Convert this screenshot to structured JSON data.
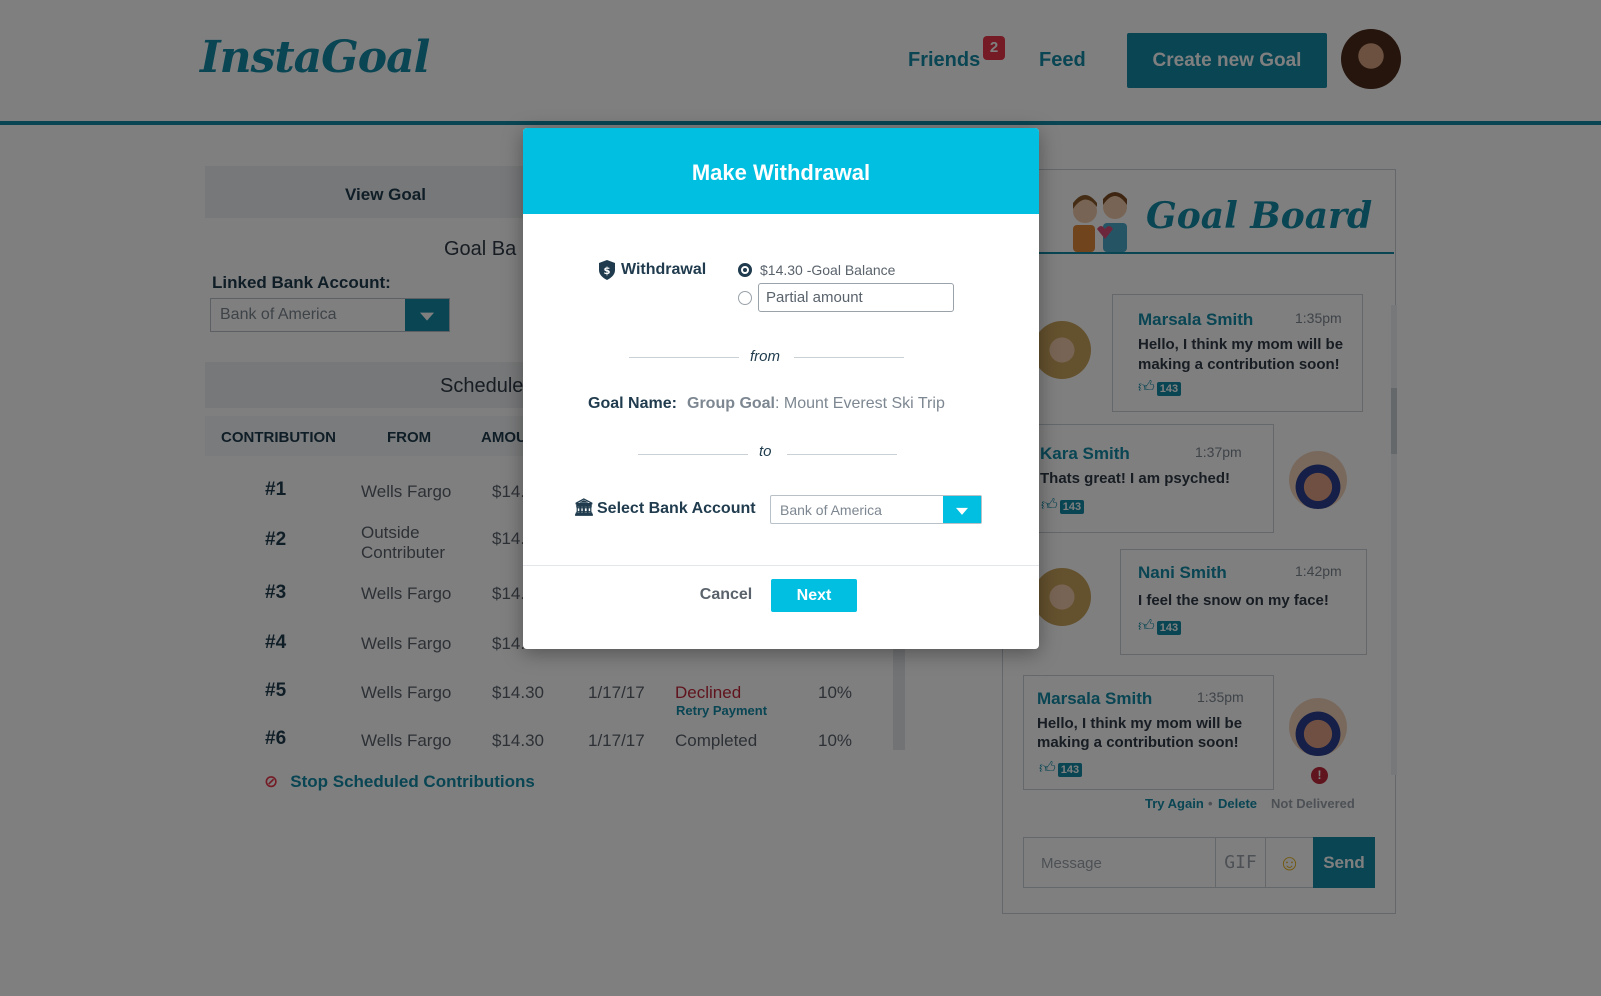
{
  "header": {
    "logo": "InstaGoal",
    "nav": {
      "friends": "Friends",
      "friends_badge": "2",
      "feed": "Feed"
    },
    "create_button": "Create new Goal"
  },
  "left": {
    "view_goal": "View Goal",
    "goal_balance_partial": "Goal Ba",
    "linked_label": "Linked Bank Account:",
    "linked_value": "Bank of America",
    "scheduled_partial": "Schedule",
    "columns": [
      "CONTRIBUTION",
      "FROM",
      "AMOU"
    ],
    "rows": [
      {
        "num": "#1",
        "from": "Wells Fargo",
        "amount": "$14.",
        "date": "",
        "status": "",
        "pct": ""
      },
      {
        "num": "#2",
        "from": "Outside Contributer",
        "amount": "$14.",
        "date": "",
        "status": "",
        "pct": ""
      },
      {
        "num": "#3",
        "from": "Wells Fargo",
        "amount": "$14.",
        "date": "",
        "status": "",
        "pct": ""
      },
      {
        "num": "#4",
        "from": "Wells Fargo",
        "amount": "$14.",
        "date": "",
        "status": "",
        "pct": ""
      },
      {
        "num": "#5",
        "from": "Wells Fargo",
        "amount": "$14.30",
        "date": "1/17/17",
        "status": "Declined",
        "retry": "Retry Payment",
        "pct": "10%"
      },
      {
        "num": "#6",
        "from": "Wells Fargo",
        "amount": "$14.30",
        "date": "1/17/17",
        "status": "Completed",
        "pct": "10%"
      }
    ],
    "stop_label": "Stop Scheduled Contributions"
  },
  "board": {
    "title": "Goal Board",
    "messages": [
      {
        "name": "Marsala Smith",
        "time": "1:35pm",
        "text": [
          "Hello, I think my mom will be",
          "making a contribution soon!"
        ],
        "likes": "143"
      },
      {
        "name": "Kara Smith",
        "time": "1:37pm",
        "text": [
          "Thats great! I am psyched!"
        ],
        "likes": "143"
      },
      {
        "name": "Nani Smith",
        "time": "1:42pm",
        "text": [
          "I feel the snow on my face!"
        ],
        "likes": "143"
      },
      {
        "name": "Marsala Smith",
        "time": "1:35pm",
        "text": [
          "Hello, I think my mom will be",
          "making a contribution soon!"
        ],
        "likes": "143"
      }
    ],
    "try_again": "Try Again",
    "delete": "Delete",
    "not_delivered": "Not Delivered",
    "message_placeholder": "Message",
    "gif": "GIF",
    "send": "Send"
  },
  "modal": {
    "title": "Make Withdrawal",
    "withdrawal_label": "Withdrawal",
    "option_full": "$14.30 -Goal Balance",
    "option_partial_placeholder": "Partial amount",
    "from": "from",
    "goal_name_label": "Goal Name:",
    "goal_name_type": "Group Goal",
    "goal_name_value": ": Mount Everest Ski Trip",
    "to": "to",
    "select_bank_label": "Select Bank Account",
    "select_bank_value": "Bank of America",
    "cancel": "Cancel",
    "next": "Next"
  },
  "colors": {
    "brand": "#128ba7",
    "modal_accent": "#00bfe1",
    "danger": "#e8364b"
  },
  "icons": [
    "shield-icon",
    "bank-icon",
    "chevron-down-icon",
    "thumbs-up-icon",
    "stop-icon",
    "emoji-icon",
    "error-icon",
    "couple-icon"
  ]
}
